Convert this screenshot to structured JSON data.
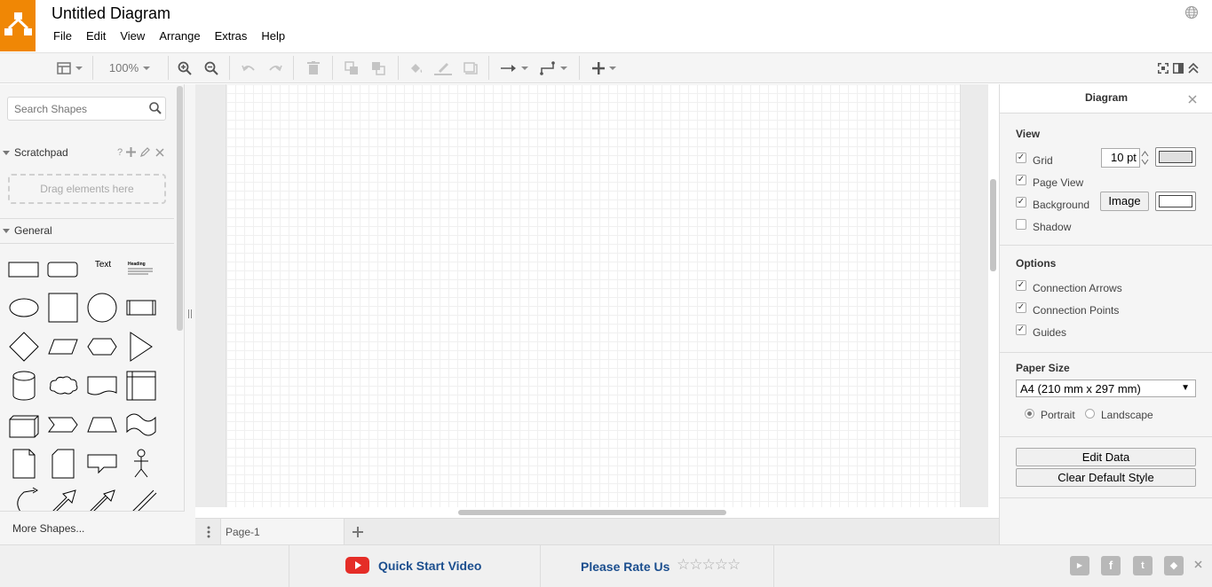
{
  "app": {
    "title": "Untitled Diagram",
    "brand_color": "#f08705"
  },
  "menu": [
    "File",
    "Edit",
    "View",
    "Arrange",
    "Extras",
    "Help"
  ],
  "toolbar": {
    "zoom": "100%"
  },
  "sidebar": {
    "search_placeholder": "Search Shapes",
    "scratchpad": {
      "label": "Scratchpad",
      "help": "?",
      "dropzone": "Drag elements here"
    },
    "general": {
      "label": "General",
      "text_shape": "Text",
      "heading_shape": "Heading"
    },
    "more_shapes": "More Shapes..."
  },
  "pages": {
    "current": "Page-1"
  },
  "format_panel": {
    "title": "Diagram",
    "view": {
      "header": "View",
      "grid": {
        "label": "Grid",
        "checked": true,
        "size": "10 pt"
      },
      "page_view": {
        "label": "Page View",
        "checked": true
      },
      "background": {
        "label": "Background",
        "checked": true,
        "button": "Image"
      },
      "shadow": {
        "label": "Shadow",
        "checked": false
      }
    },
    "options": {
      "header": "Options",
      "items": [
        {
          "label": "Connection Arrows",
          "checked": true
        },
        {
          "label": "Connection Points",
          "checked": true
        },
        {
          "label": "Guides",
          "checked": true
        }
      ]
    },
    "paper": {
      "header": "Paper Size",
      "selected": "A4 (210 mm x 297 mm)",
      "portrait": "Portrait",
      "landscape": "Landscape",
      "orientation": "portrait"
    },
    "buttons": {
      "edit_data": "Edit Data",
      "clear_style": "Clear Default Style"
    }
  },
  "footer": {
    "quick_start": "Quick Start Video",
    "rate": "Please Rate Us",
    "youtube_color": "#e52d27",
    "link_color": "#1b4e8e"
  }
}
